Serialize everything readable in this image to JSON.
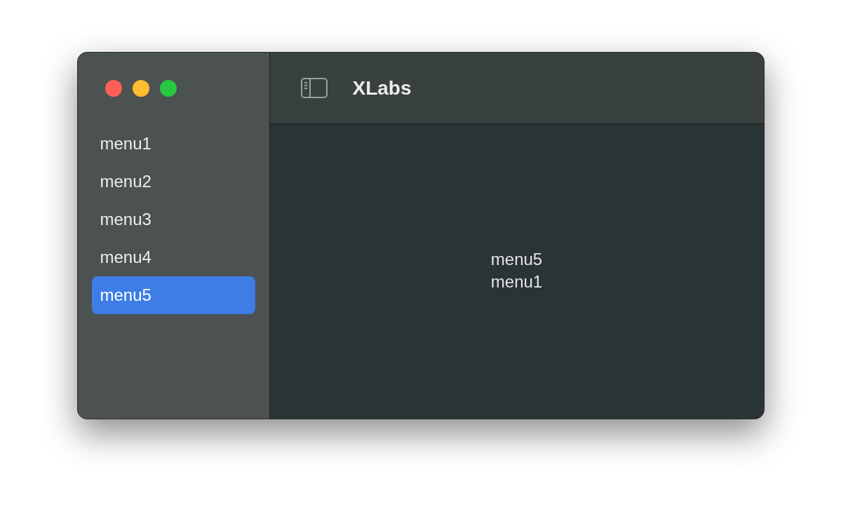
{
  "window": {
    "traffic_lights": [
      {
        "color": "#ff5f57"
      },
      {
        "color": "#febc2e"
      },
      {
        "color": "#28c840"
      }
    ]
  },
  "sidebar": {
    "items": [
      {
        "label": "menu1",
        "selected": false
      },
      {
        "label": "menu2",
        "selected": false
      },
      {
        "label": "menu3",
        "selected": false
      },
      {
        "label": "menu4",
        "selected": false
      },
      {
        "label": "menu5",
        "selected": true
      }
    ]
  },
  "toolbar": {
    "title": "XLabs"
  },
  "content": {
    "lines": [
      "menu5",
      "menu1"
    ]
  }
}
